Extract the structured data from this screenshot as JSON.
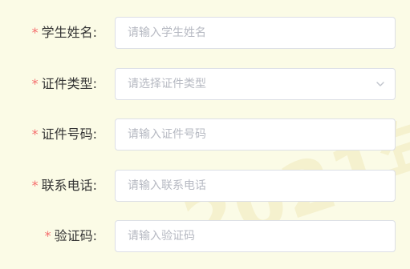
{
  "form": {
    "fields": [
      {
        "label": "学生姓名:",
        "required_mark": "*",
        "placeholder": "请输入学生姓名",
        "value": ""
      },
      {
        "label": "证件类型:",
        "required_mark": "*",
        "placeholder": "请选择证件类型",
        "value": "",
        "icon": "chevron-down-icon"
      },
      {
        "label": "证件号码:",
        "required_mark": "*",
        "placeholder": "请输入证件号码",
        "value": ""
      },
      {
        "label": "联系电话:",
        "required_mark": "*",
        "placeholder": "请输入联系电话",
        "value": ""
      },
      {
        "label": "验证码:",
        "required_mark": "*",
        "placeholder": "请输入验证码",
        "value": ""
      }
    ]
  },
  "watermark": {
    "text": "2021年"
  },
  "colors": {
    "background": "#fbfbe6",
    "required": "#f56c6c",
    "label": "#333333",
    "border": "#dcdfe6",
    "placeholder": "#b6b9c2"
  }
}
